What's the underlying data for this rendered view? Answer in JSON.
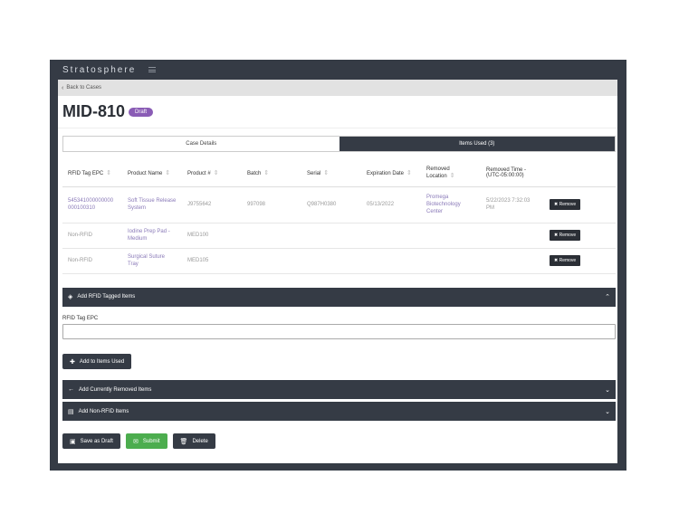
{
  "app": {
    "brand": "Stratosphere"
  },
  "nav": {
    "back": "Back to Cases"
  },
  "case": {
    "title": "MID-810",
    "status": "Draft"
  },
  "tabs": [
    {
      "label": "Case Details",
      "active": false
    },
    {
      "label": "Items Used (3)",
      "active": true
    }
  ],
  "table": {
    "headers": [
      "RFID Tag EPC",
      "Product Name",
      "Product #",
      "Batch",
      "Serial",
      "Expiration Date",
      "Removed Location",
      "Removed Time - (UTC-05:00:00)"
    ],
    "rows": [
      {
        "epc": "545341000000000 000100310",
        "product_name": "Soft Tissue Release System",
        "product_no": "J9755642",
        "batch": "997098",
        "serial": "Q987H0380",
        "expiration": "05/13/2022",
        "location": "Promega Biotechnology Center",
        "time": "5/22/2023 7:32:03 PM",
        "action": "Remove"
      },
      {
        "epc": "Non-RFID",
        "product_name": "Iodine Prep Pad - Medium",
        "product_no": "MED100",
        "batch": "",
        "serial": "",
        "expiration": "",
        "location": "",
        "time": "",
        "action": "Remove"
      },
      {
        "epc": "Non-RFID",
        "product_name": "Surgical Suture Tray",
        "product_no": "MED105",
        "batch": "",
        "serial": "",
        "expiration": "",
        "location": "",
        "time": "",
        "action": "Remove"
      }
    ]
  },
  "panels": {
    "rfid": {
      "label": "Add RFID Tagged Items",
      "icon": "tag-icon",
      "expanded": true
    },
    "removed": {
      "label": "Add Currently Removed Items",
      "icon": "arrow-left-icon",
      "expanded": false
    },
    "nonrfid": {
      "label": "Add Non-RFID Items",
      "icon": "list-icon",
      "expanded": false
    }
  },
  "form": {
    "field_label": "RFID Tag EPC",
    "value": "",
    "add_button": "Add to Items Used"
  },
  "actions": {
    "save_draft": "Save as Draft",
    "submit": "Submit",
    "delete": "Delete"
  },
  "colors": {
    "dark": "#353b45",
    "accent": "#8a5cb5",
    "success": "#4cad4e"
  }
}
